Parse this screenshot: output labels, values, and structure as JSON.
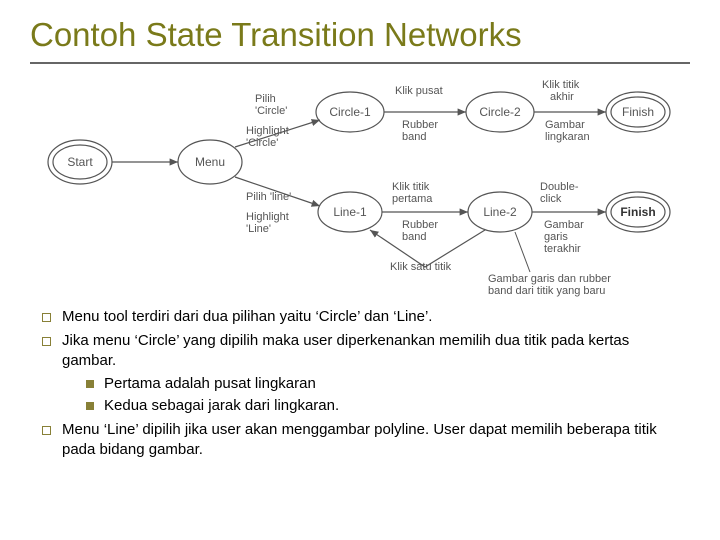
{
  "title": "Contoh State Transition Networks",
  "bullets": {
    "b1": "Menu tool terdiri dari dua pilihan yaitu ‘Circle’ dan ‘Line’.",
    "b2": "Jika menu ‘Circle’ yang dipilih maka user diperkenankan memilih dua titik pada kertas gambar.",
    "b2a": "Pertama adalah pusat lingkaran",
    "b2b": "Kedua sebagai jarak dari lingkaran.",
    "b3": "Menu ‘Line’ dipilih jika user akan menggambar polyline. User dapat memilih beberapa titik pada bidang gambar."
  },
  "diagram": {
    "start": "Start",
    "menu": "Menu",
    "circle1": "Circle-1",
    "circle2": "Circle-2",
    "finish": "Finish",
    "line1": "Line-1",
    "line2": "Line-2",
    "pilih_circle_a": "Pilih",
    "pilih_circle_b": "'Circle'",
    "hl_circle_a": "Highlight",
    "hl_circle_b": "'Circle'",
    "klik_pusat": "Klik pusat",
    "rubber_a": "Rubber",
    "rubber_b": "band",
    "klik_titik_a": "Klik titik",
    "klik_akhir": "akhir",
    "gambar_ling_a": "Gambar",
    "gambar_ling_b": "lingkaran",
    "pilih_line_a": "Pilih 'line'",
    "hl_line_a": "Highlight",
    "hl_line_b": "'Line'",
    "klik_pertama_a": "Klik titik",
    "klik_pertama_b": "pertama",
    "dbl_a": "Double-",
    "dbl_b": "click",
    "garis_a": "Gambar",
    "garis_b": "garis",
    "garis_c": "terakhir",
    "klik_satu": "Klik satu titik",
    "rubberloop_a": "Gambar garis dan rubber",
    "rubberloop_b": "band dari titik yang baru"
  }
}
